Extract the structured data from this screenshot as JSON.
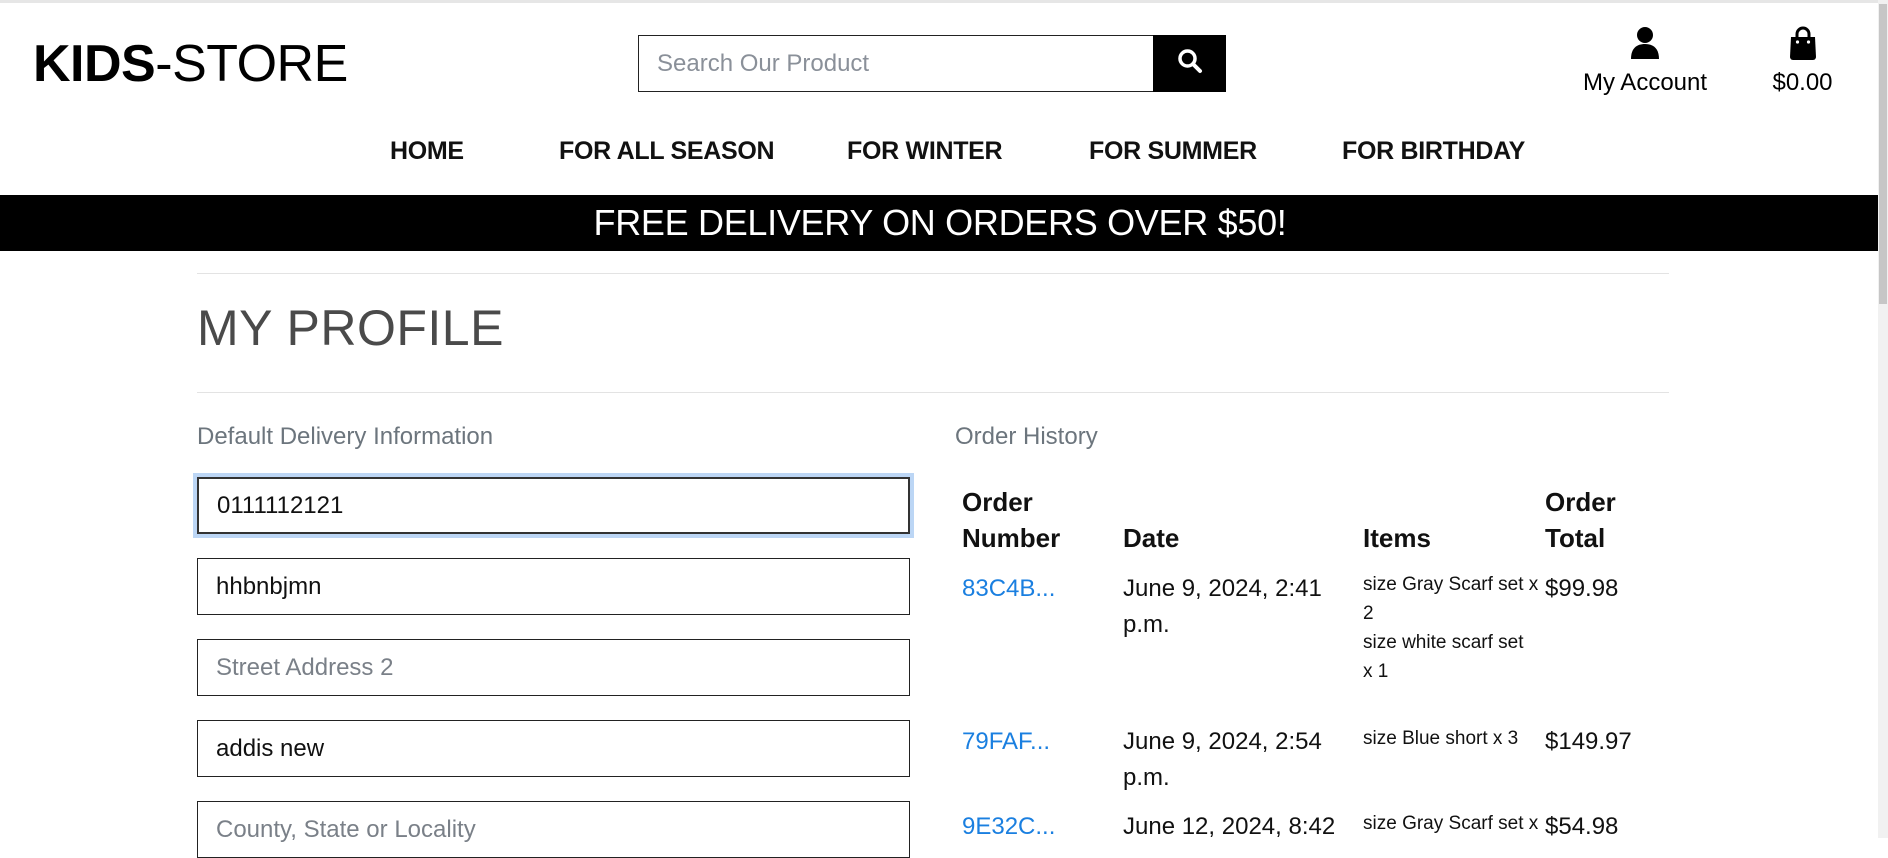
{
  "header": {
    "logo_bold": "KIDS",
    "logo_rest": "-STORE",
    "search_placeholder": "Search Our Product",
    "account_label": "My Account",
    "cart_total": "$0.00"
  },
  "nav": {
    "items": [
      "HOME",
      "FOR ALL SEASON",
      "FOR WINTER",
      "FOR SUMMER",
      "FOR BIRTHDAY"
    ]
  },
  "banner": "FREE DELIVERY ON ORDERS OVER $50!",
  "profile": {
    "title": "MY PROFILE",
    "delivery_heading": "Default Delivery Information",
    "fields": [
      {
        "value": "0111112121",
        "placeholder": ""
      },
      {
        "value": "hhbnbjmn",
        "placeholder": ""
      },
      {
        "value": "",
        "placeholder": "Street Address 2"
      },
      {
        "value": "addis new",
        "placeholder": ""
      },
      {
        "value": "",
        "placeholder": "County, State or Locality"
      }
    ]
  },
  "orders": {
    "heading": "Order History",
    "columns": {
      "number_l1": "Order",
      "number_l2": "Number",
      "date": "Date",
      "items": "Items",
      "total_l1": "Order",
      "total_l2": "Total"
    },
    "rows": [
      {
        "number": "83C4B...",
        "date_l1": "June 9, 2024, 2:41",
        "date_l2": "p.m.",
        "items": [
          "size Gray Scarf set x",
          "2",
          "size white scarf set",
          "x 1"
        ],
        "total": "$99.98"
      },
      {
        "number": "79FAF...",
        "date_l1": "June 9, 2024, 2:54",
        "date_l2": "p.m.",
        "items": [
          "size Blue short x 3"
        ],
        "total": "$149.97"
      },
      {
        "number": "9E32C...",
        "date_l1": "June 12, 2024, 8:42",
        "date_l2": "",
        "items": [
          "size Gray Scarf set x"
        ],
        "total": "$54.98"
      }
    ]
  }
}
